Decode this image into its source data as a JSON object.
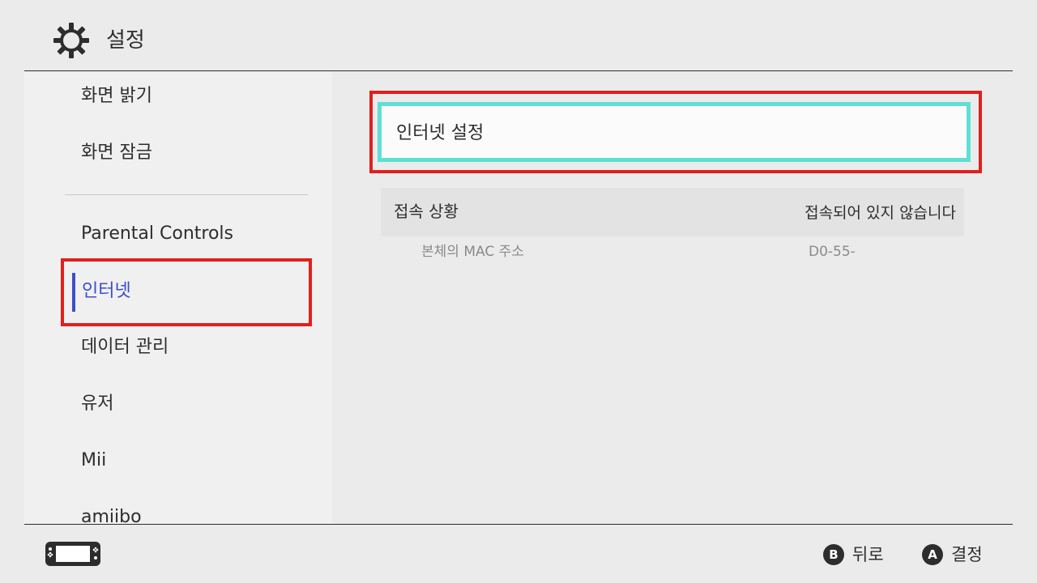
{
  "header": {
    "title": "설정",
    "icon": "gear-icon"
  },
  "sidebar": {
    "items": [
      {
        "label": "화면 밝기"
      },
      {
        "label": "화면 잠금"
      },
      {
        "label": "Parental Controls"
      },
      {
        "label": "인터넷",
        "selected": true
      },
      {
        "label": "데이터 관리"
      },
      {
        "label": "유저"
      },
      {
        "label": "Mii"
      },
      {
        "label": "amiibo"
      }
    ],
    "selected_color": "#3b4fc8"
  },
  "main": {
    "internet_settings_label": "인터넷 설정",
    "connection_status": {
      "label": "접속 상황",
      "value": "접속되어 있지 않습니다"
    },
    "mac_address": {
      "label": "본체의 MAC 주소",
      "value": "D0-55-"
    }
  },
  "footer": {
    "console_icon": "switch-console-icon",
    "back": {
      "button": "B",
      "label": "뒤로"
    },
    "confirm": {
      "button": "A",
      "label": "결정"
    }
  },
  "colors": {
    "highlight_red": "#e0201e",
    "cursor_cyan": "#5ee0d3",
    "background": "#ebebeb"
  }
}
